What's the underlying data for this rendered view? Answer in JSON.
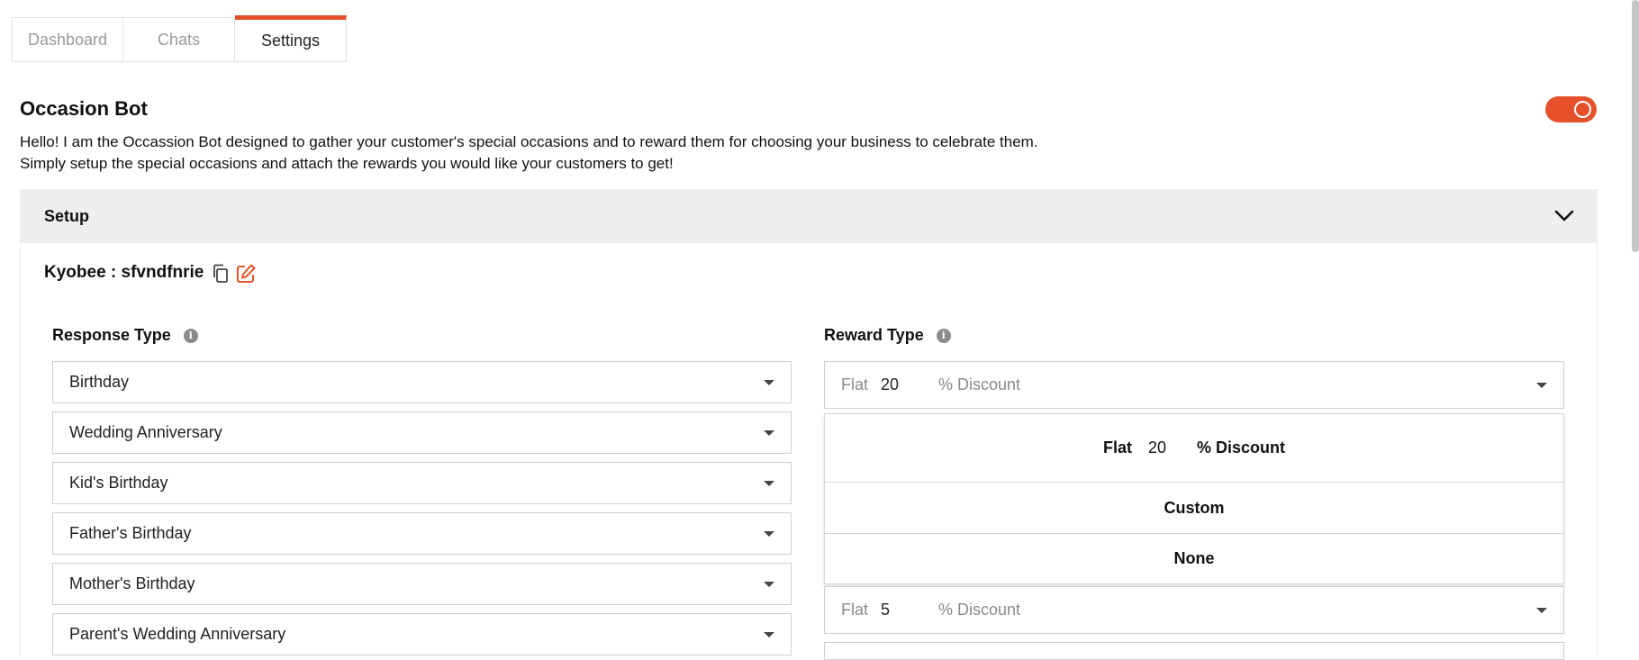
{
  "tabs": [
    {
      "label": "Dashboard",
      "active": false
    },
    {
      "label": "Chats",
      "active": false
    },
    {
      "label": "Settings",
      "active": true
    }
  ],
  "bot": {
    "title": "Occasion Bot",
    "enabled": true,
    "description_line1": "Hello! I am the Occassion Bot designed to gather your customer's special occasions and to reward them for choosing your business to celebrate them.",
    "description_line2": "Simply setup the special occasions and attach the rewards you would like your customers to get!"
  },
  "setup": {
    "header": "Setup",
    "bot_id": "Kyobee : sfvndfnrie",
    "response_type_label": "Response Type",
    "reward_type_label": "Reward Type",
    "response_types": [
      "Birthday",
      "Wedding Anniversary",
      "Kid's Birthday",
      "Father's Birthday",
      "Mother's Birthday",
      "Parent's Wedding Anniversary"
    ],
    "rewards": [
      {
        "flat_label": "Flat",
        "value": "20",
        "suffix": "% Discount"
      },
      {
        "flat_label": "Flat",
        "value": "5",
        "suffix": "% Discount"
      }
    ],
    "reward_dropdown": {
      "option_flat": {
        "flat_label": "Flat",
        "value": "20",
        "suffix": "% Discount"
      },
      "option_custom": "Custom",
      "option_none": "None"
    }
  },
  "colors": {
    "accent": "#e4512b",
    "panel_header_bg": "#eeeeee"
  }
}
